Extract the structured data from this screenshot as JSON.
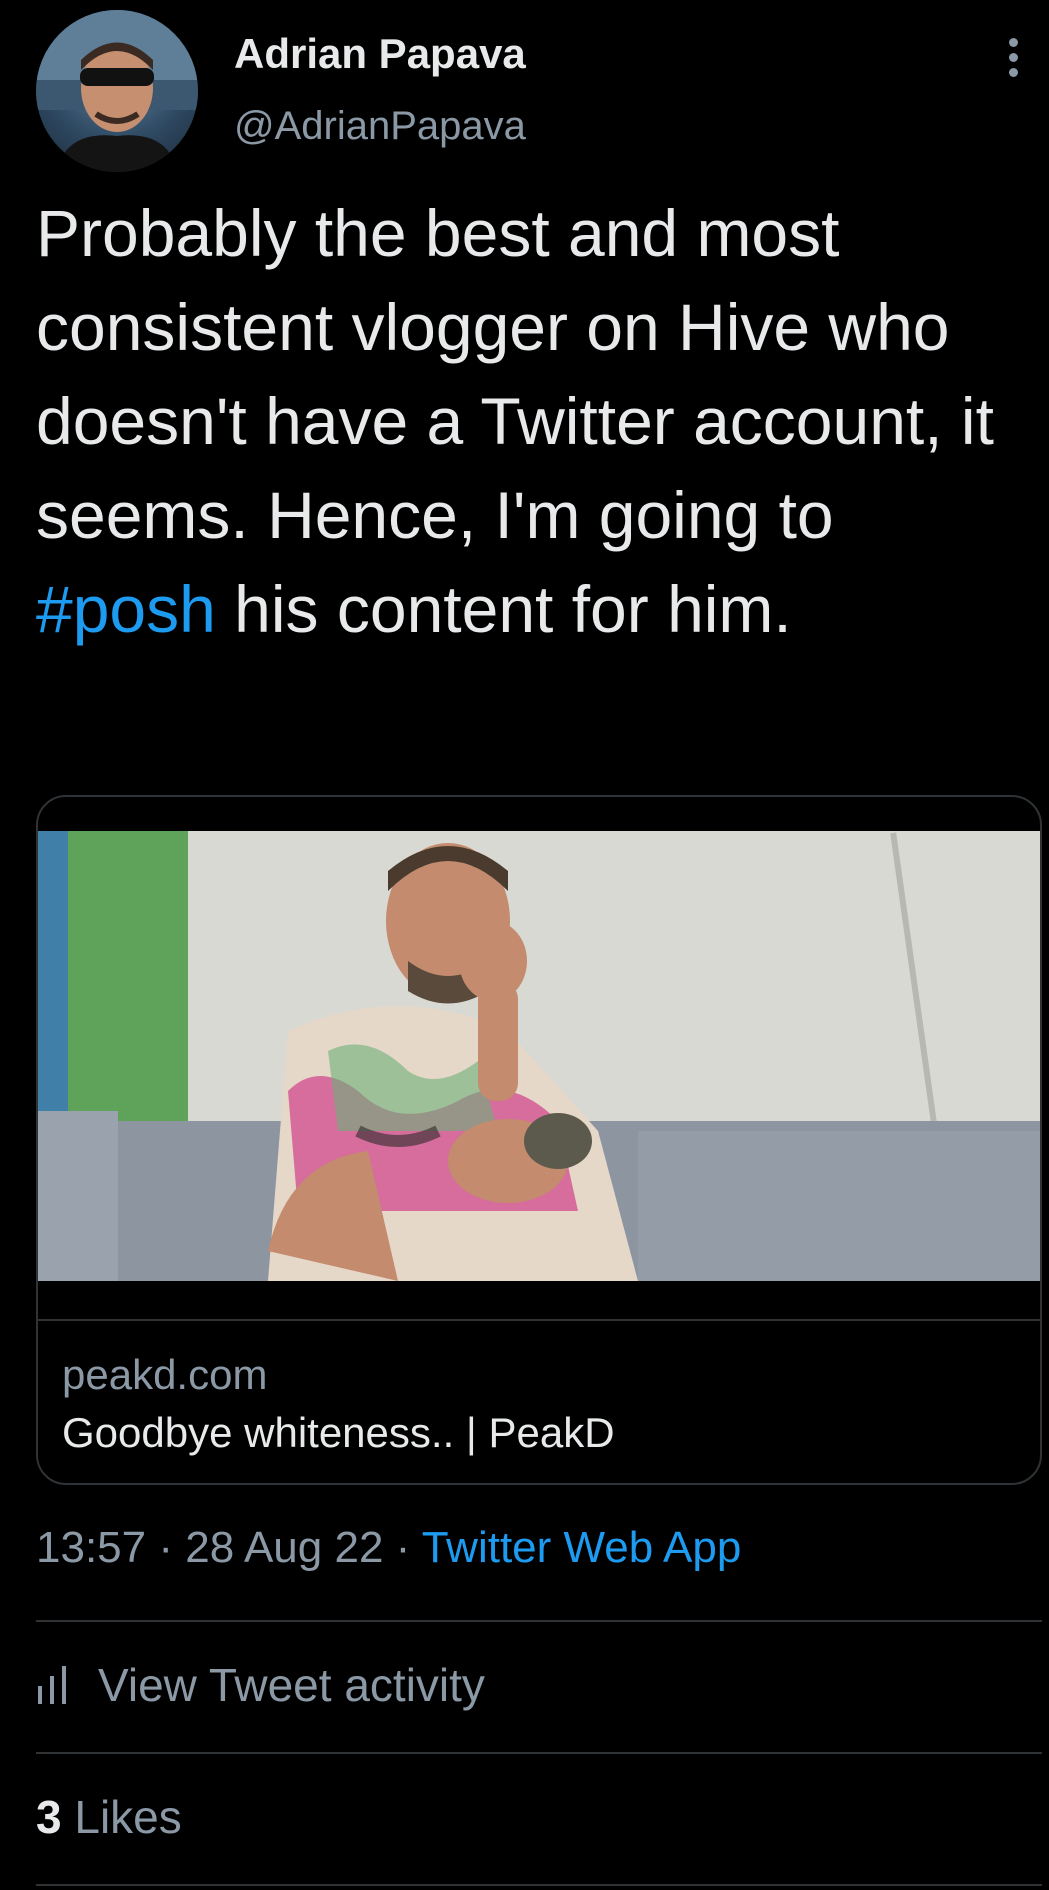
{
  "author": {
    "name": "Adrian Papava",
    "handle": "@AdrianPapava"
  },
  "tweet": {
    "text_before": "Probably the best and most consistent vlogger on Hive who doesn't have a Twitter account, it seems. Hence, I'm going to ",
    "hashtag": "#posh",
    "text_after": " his content for him."
  },
  "card": {
    "domain": "peakd.com",
    "title": "Goodbye whiteness.. | PeakD"
  },
  "meta": {
    "time": "13:57",
    "separator": " · ",
    "date": "28 Aug 22",
    "source": "Twitter Web App"
  },
  "activity": {
    "label": "View Tweet activity"
  },
  "likes": {
    "count": "3",
    "label": "Likes"
  },
  "colors": {
    "background": "#000000",
    "text": "#e7e9ea",
    "secondary": "#8b98a5",
    "accent": "#1d9bf0",
    "border": "#2f3336"
  },
  "icons": [
    "more-vertical-icon",
    "bar-chart-icon"
  ]
}
